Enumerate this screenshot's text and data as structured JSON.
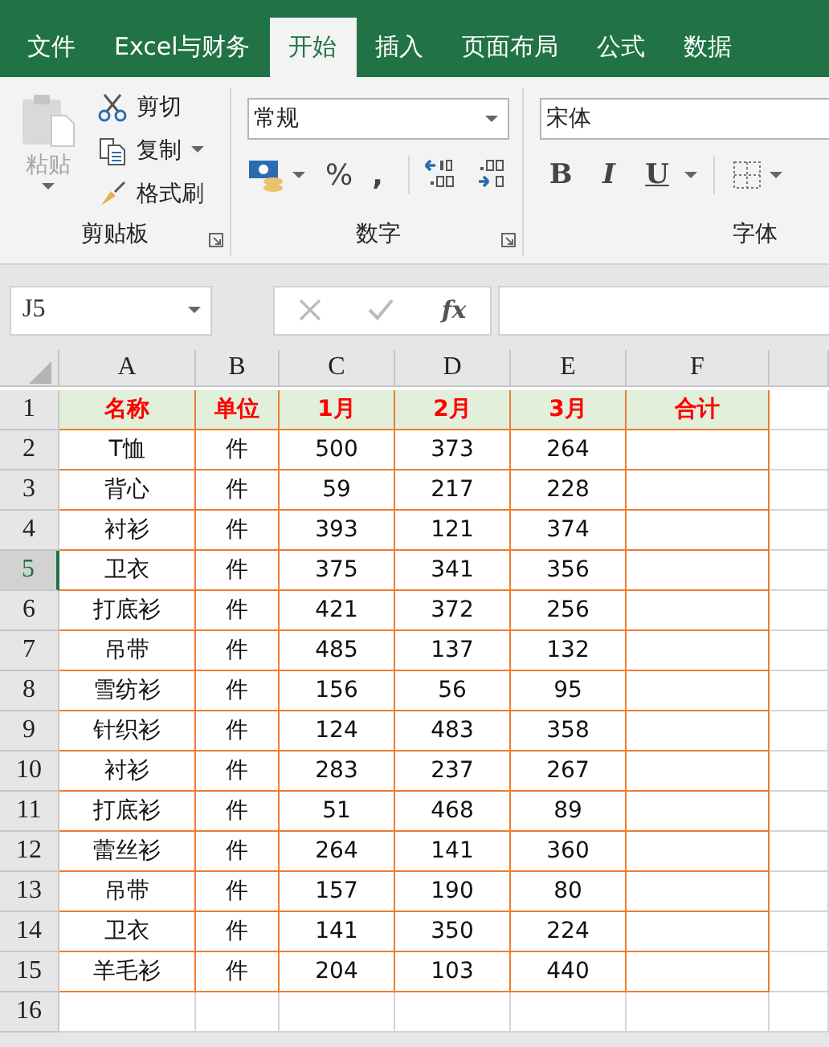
{
  "tabs": [
    {
      "label": "文件",
      "selected": false
    },
    {
      "label": "Excel与财务",
      "selected": false
    },
    {
      "label": "开始",
      "selected": true
    },
    {
      "label": "插入",
      "selected": false
    },
    {
      "label": "页面布局",
      "selected": false
    },
    {
      "label": "公式",
      "selected": false
    },
    {
      "label": "数据",
      "selected": false
    }
  ],
  "ribbon": {
    "clipboard": {
      "label": "剪贴板",
      "paste": {
        "label": "粘贴",
        "disabled": true
      },
      "items": [
        {
          "kind": "cut",
          "label": "剪切"
        },
        {
          "kind": "copy",
          "label": "复制"
        },
        {
          "kind": "painter",
          "label": "格式刷"
        }
      ]
    },
    "number": {
      "label": "数字",
      "format": "常规",
      "percent": "%",
      "comma": ","
    },
    "font": {
      "label": "字体",
      "font_name": "宋体",
      "styles": [
        "B",
        "I",
        "U"
      ]
    }
  },
  "formula_bar": {
    "name_box": "J5",
    "fx": "fx"
  },
  "sheet": {
    "columns": [
      "A",
      "B",
      "C",
      "D",
      "E",
      "F"
    ],
    "rows": [
      {
        "number": "1",
        "kind": "header",
        "selected": false,
        "cells": [
          "名称",
          "单位",
          "1月",
          "2月",
          "3月",
          "合计"
        ]
      },
      {
        "number": "2",
        "kind": "data",
        "selected": false,
        "cells": [
          "T恤",
          "件",
          "500",
          "373",
          "264"
        ]
      },
      {
        "number": "3",
        "kind": "data",
        "selected": false,
        "cells": [
          "背心",
          "件",
          "59",
          "217",
          "228"
        ]
      },
      {
        "number": "4",
        "kind": "data",
        "selected": false,
        "cells": [
          "衬衫",
          "件",
          "393",
          "121",
          "374"
        ]
      },
      {
        "number": "5",
        "kind": "data",
        "selected": true,
        "cells": [
          "卫衣",
          "件",
          "375",
          "341",
          "356"
        ]
      },
      {
        "number": "6",
        "kind": "data",
        "selected": false,
        "cells": [
          "打底衫",
          "件",
          "421",
          "372",
          "256"
        ]
      },
      {
        "number": "7",
        "kind": "data",
        "selected": false,
        "cells": [
          "吊带",
          "件",
          "485",
          "137",
          "132"
        ]
      },
      {
        "number": "8",
        "kind": "data",
        "selected": false,
        "cells": [
          "雪纺衫",
          "件",
          "156",
          "56",
          "95"
        ]
      },
      {
        "number": "9",
        "kind": "data",
        "selected": false,
        "cells": [
          "针织衫",
          "件",
          "124",
          "483",
          "358"
        ]
      },
      {
        "number": "10",
        "kind": "data",
        "selected": false,
        "cells": [
          "衬衫",
          "件",
          "283",
          "237",
          "267"
        ]
      },
      {
        "number": "11",
        "kind": "data",
        "selected": false,
        "cells": [
          "打底衫",
          "件",
          "51",
          "468",
          "89"
        ]
      },
      {
        "number": "12",
        "kind": "data",
        "selected": false,
        "cells": [
          "蕾丝衫",
          "件",
          "264",
          "141",
          "360"
        ]
      },
      {
        "number": "13",
        "kind": "data",
        "selected": false,
        "cells": [
          "吊带",
          "件",
          "157",
          "190",
          "80"
        ]
      },
      {
        "number": "14",
        "kind": "data",
        "selected": false,
        "cells": [
          "卫衣",
          "件",
          "141",
          "350",
          "224"
        ]
      },
      {
        "number": "15",
        "kind": "data",
        "selected": false,
        "cells": [
          "羊毛衫",
          "件",
          "204",
          "103",
          "440"
        ]
      },
      {
        "number": "16",
        "kind": "empty",
        "selected": false,
        "cells": []
      }
    ]
  }
}
